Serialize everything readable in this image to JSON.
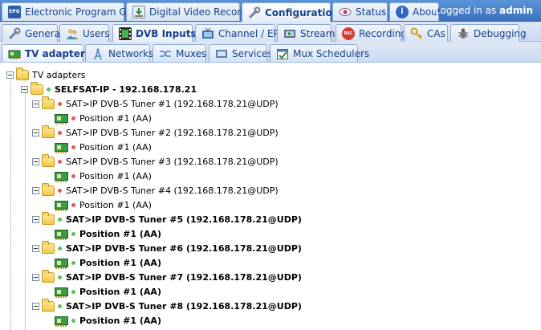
{
  "main_tabs": [
    {
      "label": "Electronic Program Guide",
      "icon": "epg-icon"
    },
    {
      "label": "Digital Video Recorder",
      "icon": "download-icon"
    },
    {
      "label": "Configuration",
      "icon": "wrench-icon"
    },
    {
      "label": "Status",
      "icon": "eye-icon"
    },
    {
      "label": "About",
      "icon": "info-icon"
    }
  ],
  "session": {
    "prefix": "Logged in as",
    "user": "admin"
  },
  "config_tabs": [
    {
      "label": "General",
      "icon": "wrench-icon"
    },
    {
      "label": "Users",
      "icon": "users-icon"
    },
    {
      "label": "DVB Inputs",
      "icon": "film-icon"
    },
    {
      "label": "Channel / EPG",
      "icon": "tv-icon"
    },
    {
      "label": "Stream",
      "icon": "stream-icon"
    },
    {
      "label": "Recording",
      "icon": "rec-icon"
    },
    {
      "label": "CAs",
      "icon": "key-icon"
    },
    {
      "label": "Debugging",
      "icon": "bug-icon"
    }
  ],
  "dvb_tabs": [
    {
      "label": "TV adapters",
      "icon": "tv-adapter-icon"
    },
    {
      "label": "Networks",
      "icon": "antenna-icon"
    },
    {
      "label": "Muxes",
      "icon": "muxes-icon"
    },
    {
      "label": "Services",
      "icon": "services-icon"
    },
    {
      "label": "Mux Schedulers",
      "icon": "scheduler-icon"
    }
  ],
  "tree": {
    "root": "TV adapters",
    "device": "SELFSAT-IP - 192.168.178.21",
    "tuners": [
      {
        "label": "SAT>IP DVB-S Tuner #1 (192.168.178.21@UDP)",
        "position": "Position #1 (AA)",
        "status": "red"
      },
      {
        "label": "SAT>IP DVB-S Tuner #2 (192.168.178.21@UDP)",
        "position": "Position #1 (AA)",
        "status": "red"
      },
      {
        "label": "SAT>IP DVB-S Tuner #3 (192.168.178.21@UDP)",
        "position": "Position #1 (AA)",
        "status": "red"
      },
      {
        "label": "SAT>IP DVB-S Tuner #4 (192.168.178.21@UDP)",
        "position": "Position #1 (AA)",
        "status": "red"
      },
      {
        "label": "SAT>IP DVB-S Tuner #5 (192.168.178.21@UDP)",
        "position": "Position #1 (AA)",
        "status": "green"
      },
      {
        "label": "SAT>IP DVB-S Tuner #6 (192.168.178.21@UDP)",
        "position": "Position #1 (AA)",
        "status": "green"
      },
      {
        "label": "SAT>IP DVB-S Tuner #7 (192.168.178.21@UDP)",
        "position": "Position #1 (AA)",
        "status": "green"
      },
      {
        "label": "SAT>IP DVB-S Tuner #8 (192.168.178.21@UDP)",
        "position": "Position #1 (AA)",
        "status": "green"
      }
    ]
  }
}
